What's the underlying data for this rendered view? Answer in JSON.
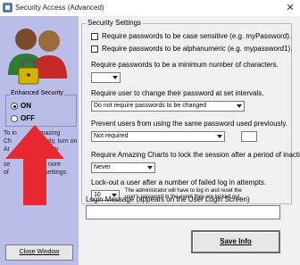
{
  "window": {
    "title": "Security Access (Advanced)",
    "close_glyph": "✕"
  },
  "left": {
    "icon": "users-lock-icon",
    "enhanced_security": {
      "legend": "Enhanced Security",
      "on_label": "ON",
      "off_label": "OFF",
      "selected": "ON"
    },
    "help_lines": [
      "To in",
      "Amazing",
      "Ch",
      "urity, turn on",
      "Ar",
      "ty",
      "se",
      "nore",
      "of",
      "settings."
    ],
    "arrow_icon": "red-arrow-up-icon",
    "arrow_color": "#e8282f",
    "close_window_label": "Close Window"
  },
  "settings": {
    "legend": "Security Settings",
    "case_sensitive_label": "Require passwords to be case sensitive (e.g. myPassword).",
    "alphanumeric_label": "Require passwords to be alphanumeric (e.g. mypassword1).",
    "min_chars_label": "Require passwords to be a minimum number of characters.",
    "min_chars_value": "",
    "change_label": "Require user to change their password at set intervals.",
    "change_value": "Do not require passwords to be changed",
    "reuse_label": "Prevent users from using the same password used previously.",
    "reuse_value": "Not required",
    "reuse_count": "",
    "lock_label": "Require Amazing Charts to lock the session after a period of inactivity.",
    "lock_value": "Never",
    "lockout_label": "Lock-out a user after a number of failed log in attempts.",
    "lockout_value": "10",
    "lockout_note_1": "The administrator will have to log in and reset the",
    "lockout_note_2": "user's password in the event they are locked out."
  },
  "login_message": {
    "label": "Login Message (appears on the User Login Screen)",
    "value": ""
  },
  "save_label": "Save Info"
}
